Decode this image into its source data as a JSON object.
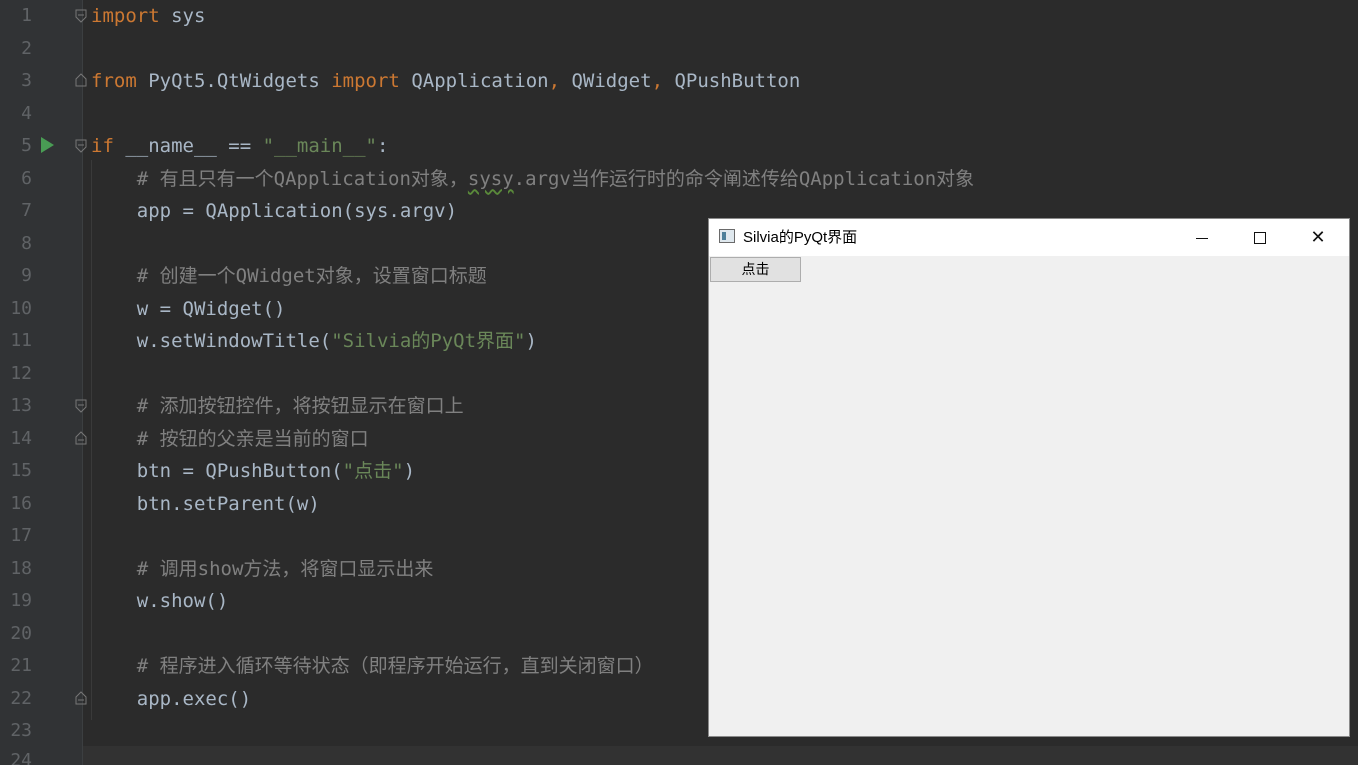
{
  "editor": {
    "line_numbers": [
      "1",
      "2",
      "3",
      "4",
      "5",
      "6",
      "7",
      "8",
      "9",
      "10",
      "11",
      "12",
      "13",
      "14",
      "15",
      "16",
      "17",
      "18",
      "19",
      "20",
      "21",
      "22",
      "23",
      "24"
    ],
    "line1": {
      "kw": "import",
      "rest": " sys"
    },
    "line3": {
      "kw1": "from",
      "mid": " PyQt5.QtWidgets ",
      "kw2": "import",
      "rest1": " QApplication",
      "comma1": ",",
      "rest2": " QWidget",
      "comma2": ",",
      "rest3": " QPushButton"
    },
    "line5": {
      "kw": "if",
      "mid": " __name__ == ",
      "str": "\"__main__\"",
      "end": ":"
    },
    "line6": {
      "c1": "    # 有且只有一个QApplication对象，",
      "squiggle": "sysy",
      "c2": ".argv当作运行时的命令阐述传给QApplication对象"
    },
    "line7": "    app = QApplication(sys.argv)",
    "line9": "    # 创建一个QWidget对象，设置窗口标题",
    "line10": "    w = QWidget()",
    "line11": {
      "pre": "    w.setWindowTitle(",
      "str": "\"Silvia的PyQt界面\"",
      "post": ")"
    },
    "line13": "    # 添加按钮控件，将按钮显示在窗口上",
    "line14": "    # 按钮的父亲是当前的窗口",
    "line15": {
      "pre": "    btn = QPushButton(",
      "str": "\"点击\"",
      "post": ")"
    },
    "line16": "    btn.setParent(w)",
    "line18": "    # 调用show方法，将窗口显示出来",
    "line19": "    w.show()",
    "line21": "    # 程序进入循环等待状态（即程序开始运行，直到关闭窗口）",
    "line22": "    app.exec()"
  },
  "qt_window": {
    "title": "Silvia的PyQt界面",
    "button_label": "点击",
    "minimize_glyph": "",
    "close_glyph": "✕"
  },
  "colors": {
    "editor_bg": "#2b2b2b",
    "keyword": "#cc7832",
    "string": "#6a8759",
    "comment": "#808080",
    "text": "#a9b7c6"
  }
}
